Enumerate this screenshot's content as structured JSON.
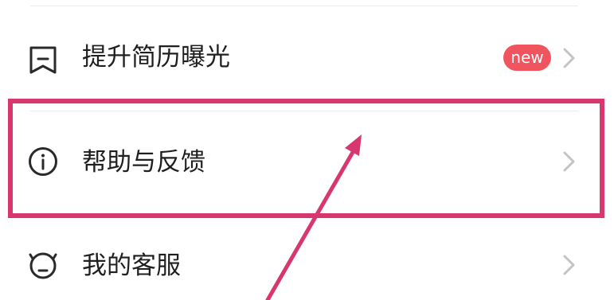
{
  "menu": {
    "items": [
      {
        "label": "提升简历曝光",
        "icon": "bookmark-icon",
        "badge": "new"
      },
      {
        "label": "帮助与反馈",
        "icon": "info-icon"
      },
      {
        "label": "我的客服",
        "icon": "service-icon"
      }
    ]
  },
  "colors": {
    "badge": "#f0545f",
    "annotation": "#d7366f",
    "divider": "#ececec",
    "label": "#1f1f1f",
    "chevron": "#c4c4c4",
    "icon": "#2a2a2a"
  }
}
